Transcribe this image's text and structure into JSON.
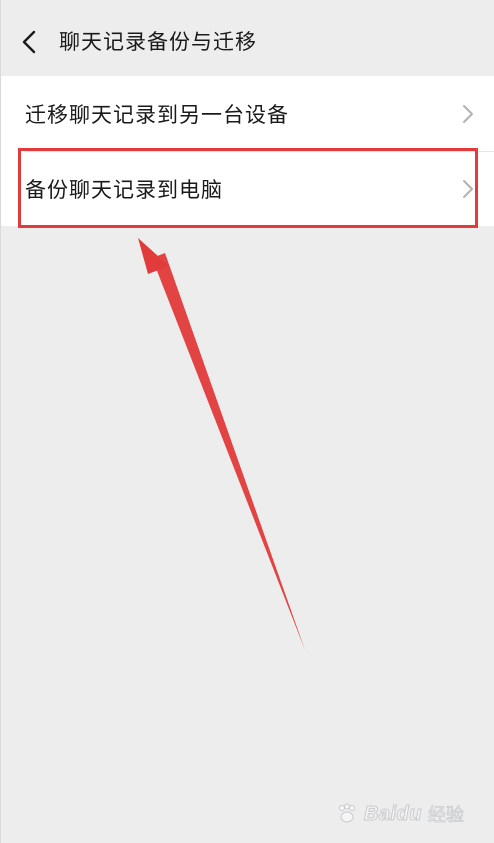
{
  "header": {
    "title": "聊天记录备份与迁移",
    "back_icon": "chevron-left-icon"
  },
  "list": {
    "items": [
      {
        "label": "迁移聊天记录到另一台设备",
        "icon": "chevron-right-icon"
      },
      {
        "label": "备份聊天记录到电脑",
        "icon": "chevron-right-icon"
      }
    ]
  },
  "annotation": {
    "highlight_color": "#e23b3b",
    "arrow_color": "#e23b3b"
  },
  "watermark": {
    "brand": "Baidu",
    "sub": "经验"
  },
  "colors": {
    "background": "#ededed",
    "card": "#ffffff",
    "text": "#1a1a1a",
    "chevron": "#b2b2b2"
  }
}
